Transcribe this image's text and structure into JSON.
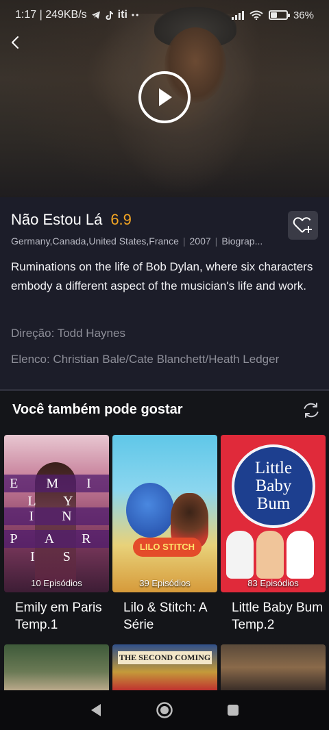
{
  "status_bar": {
    "time_net": "1:17 | 249KB/s",
    "carrier_text": "iti",
    "battery": "36%",
    "battery_level": 0.36
  },
  "movie": {
    "title": "Não Estou Lá",
    "rating": "6.9",
    "countries": "Germany,Canada,United States,France",
    "year": "2007",
    "genre": "Biograp...",
    "description": "Ruminations on the life of Bob Dylan, where six characters embody a different aspect of the musician's life and work.",
    "director": "Direção: Todd Haynes",
    "cast": "Elenco: Christian Bale/Cate Blanchett/Heath Ledger"
  },
  "recommendations": {
    "heading": "Você também pode gostar",
    "items": [
      {
        "title": "Emily em Paris Temp.1",
        "episodes": "10 Episódios",
        "poster_text": [
          "E M I L Y",
          "I N",
          "P A R I S"
        ]
      },
      {
        "title": "Lilo & Stitch: A Série",
        "episodes": "39 Episódios",
        "poster_text": [
          "LILO STITCH"
        ]
      },
      {
        "title": "Little Baby Bum Temp.2",
        "episodes": "83 Episódios",
        "poster_text": [
          "Little",
          "Baby",
          "Bum"
        ]
      }
    ],
    "second_row": [
      "",
      "THE SECOND COMING",
      ""
    ]
  },
  "colors": {
    "accent_rating": "#f5a623",
    "background": "#1c1d29",
    "recs_background": "#141519"
  }
}
